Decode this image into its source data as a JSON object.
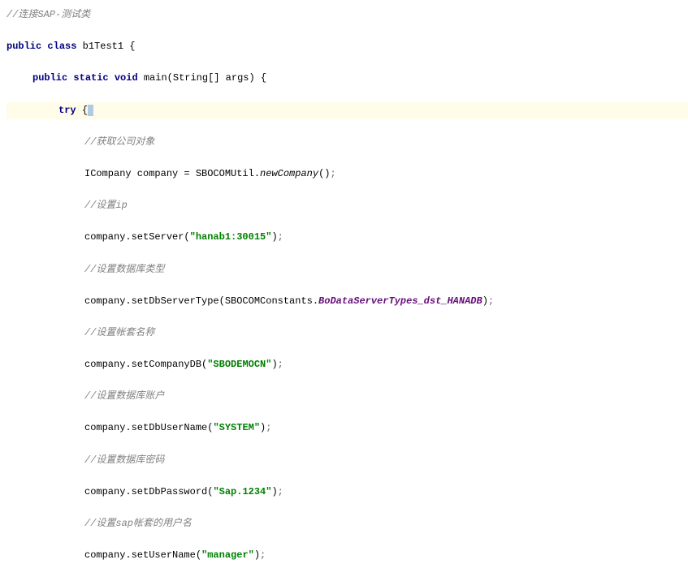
{
  "code": {
    "topComment": "//连接SAP-测试类",
    "classDecl": {
      "kw_public": "public",
      "kw_class": "class",
      "className": "b1Test1",
      "brace": "{"
    },
    "mainDecl": {
      "kw_public": "public",
      "kw_static": "static",
      "kw_void": "void",
      "methodName": "main",
      "params": "(String[] args)",
      "brace": "{"
    },
    "tryLine": {
      "kw_try": "try",
      "brace": "{"
    },
    "lines": [
      {
        "type": "comment",
        "text": "//获取公司对象"
      },
      {
        "type": "stmt_newCompany",
        "pre": "ICompany company = SBOCOMUtil.",
        "italic": "newCompany",
        "post": "()",
        "semi": ";"
      },
      {
        "type": "comment",
        "text": "//设置ip"
      },
      {
        "type": "stmt_string",
        "pre": "company.setServer(",
        "str": "\"hanab1:30015\"",
        "post": ")",
        "semi": ";"
      },
      {
        "type": "comment",
        "text": "//设置数据库类型"
      },
      {
        "type": "stmt_const",
        "pre": "company.setDbServerType(SBOCOMConstants.",
        "const": "BoDataServerTypes_dst_HANADB",
        "post": ")",
        "semi": ";"
      },
      {
        "type": "comment",
        "text": "//设置帐套名称"
      },
      {
        "type": "stmt_string",
        "pre": "company.setCompanyDB(",
        "str": "\"SBODEMOCN\"",
        "post": ")",
        "semi": ";"
      },
      {
        "type": "comment",
        "text": "//设置数据库账户"
      },
      {
        "type": "stmt_string",
        "pre": "company.setDbUserName(",
        "str": "\"SYSTEM\"",
        "post": ")",
        "semi": ";"
      },
      {
        "type": "comment",
        "text": "//设置数据库密码"
      },
      {
        "type": "stmt_string",
        "pre": "company.setDbPassword(",
        "str": "\"Sap.1234\"",
        "post": ")",
        "semi": ";"
      },
      {
        "type": "comment",
        "text": "//设置sap帐套的用户名"
      },
      {
        "type": "stmt_string",
        "pre": "company.setUserName(",
        "str": "\"manager\"",
        "post": ")",
        "semi": ";"
      }
    ]
  }
}
